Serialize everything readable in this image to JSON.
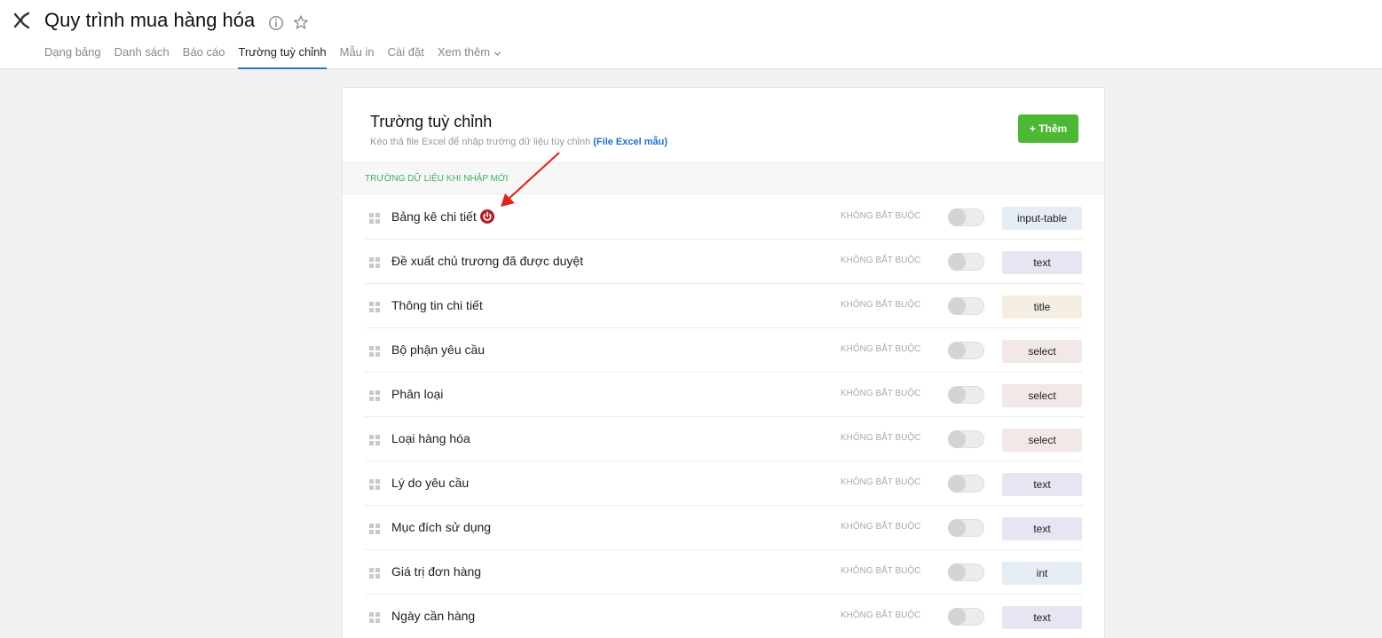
{
  "header": {
    "title": "Quy trình mua hàng hóa",
    "tabs": [
      {
        "label": "Dạng bảng"
      },
      {
        "label": "Danh sách"
      },
      {
        "label": "Báo cáo"
      },
      {
        "label": "Trường tuỳ chỉnh"
      },
      {
        "label": "Mẫu in"
      },
      {
        "label": "Cài đặt"
      },
      {
        "label": "Xem thêm"
      }
    ],
    "active_tab": "Trường tuỳ chỉnh"
  },
  "panel": {
    "title": "Trường tuỳ chỉnh",
    "subtitle": "Kéo thả file Excel để nhập trường dữ liệu tùy chỉnh",
    "excel_link": "(File Excel mẫu)",
    "add_button": "+ Thêm",
    "section_label": "TRƯỜNG DỮ LIỆU KHI NHẬP MỚI"
  },
  "fields": [
    {
      "name": "Bảng kê chi tiết",
      "required_label": "KHÔNG BẮT BUỘC",
      "required": false,
      "type": "input-table",
      "warning": true
    },
    {
      "name": "Đề xuất chủ trương đã được duyệt",
      "required_label": "KHÔNG BẮT BUỘC",
      "required": false,
      "type": "text"
    },
    {
      "name": "Thông tin chi tiết",
      "required_label": "KHÔNG BẮT BUỘC",
      "required": false,
      "type": "title"
    },
    {
      "name": "Bộ phận yêu cầu",
      "required_label": "KHÔNG BẮT BUỘC",
      "required": false,
      "type": "select"
    },
    {
      "name": "Phân loại",
      "required_label": "KHÔNG BẮT BUỘC",
      "required": false,
      "type": "select"
    },
    {
      "name": "Loại hàng hóa",
      "required_label": "KHÔNG BẮT BUỘC",
      "required": false,
      "type": "select"
    },
    {
      "name": "Lý do yêu cầu",
      "required_label": "KHÔNG BẮT BUỘC",
      "required": false,
      "type": "text"
    },
    {
      "name": "Mục đích sử dụng",
      "required_label": "KHÔNG BẮT BUỘC",
      "required": false,
      "type": "text"
    },
    {
      "name": "Giá trị đơn hàng",
      "required_label": "KHÔNG BẮT BUỘC",
      "required": false,
      "type": "int"
    },
    {
      "name": "Ngày cần hàng",
      "required_label": "KHÔNG BẮT BUỘC",
      "required": false,
      "type": "text"
    }
  ],
  "colors": {
    "accent_blue": "#1f7bd8",
    "add_button_green": "#4cb833",
    "section_label_green": "#3fae5a",
    "warning_red": "#b0202a",
    "annotation_arrow": "#e0251b"
  },
  "icons": {
    "back": "back-icon",
    "info": "info-icon",
    "star": "star-icon",
    "more_chevron": "chevron-down-icon",
    "drag": "drag-handle-icon",
    "warning": "power-icon"
  }
}
